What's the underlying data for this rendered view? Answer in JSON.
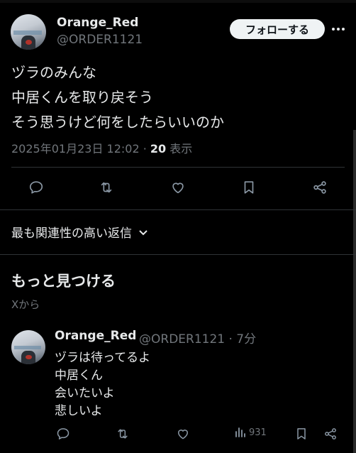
{
  "main_tweet": {
    "display_name": "Orange_Red",
    "handle": "@ORDER1121",
    "follow_label": "フォローする",
    "text_lines": [
      "ヅラのみんな",
      "中居くんを取り戻そう",
      "そう思うけど何をしたらいいのか"
    ],
    "timestamp": "2025年01月23日 12:02",
    "separator": " · ",
    "view_count": "20",
    "view_label": " 表示",
    "actions": [
      "reply-icon",
      "retweet-icon",
      "like-icon",
      "bookmark-icon",
      "share-icon"
    ]
  },
  "sort": {
    "label": "最も関連性の高い返信"
  },
  "discover": {
    "title": "もっと見つける",
    "subtitle": "Xから"
  },
  "reply": {
    "display_name": "Orange_Red",
    "handle_time": "@ORDER1121 · 7分",
    "text_lines": [
      "ヅラは待ってるよ",
      "中居くん",
      "会いたいよ",
      "悲しいよ"
    ],
    "view_count": "931"
  },
  "colors": {
    "background": "#000000",
    "text": "#e7e9ea",
    "secondary": "#71767b",
    "divider": "#2f3336",
    "button_bg": "#eff3f4"
  }
}
